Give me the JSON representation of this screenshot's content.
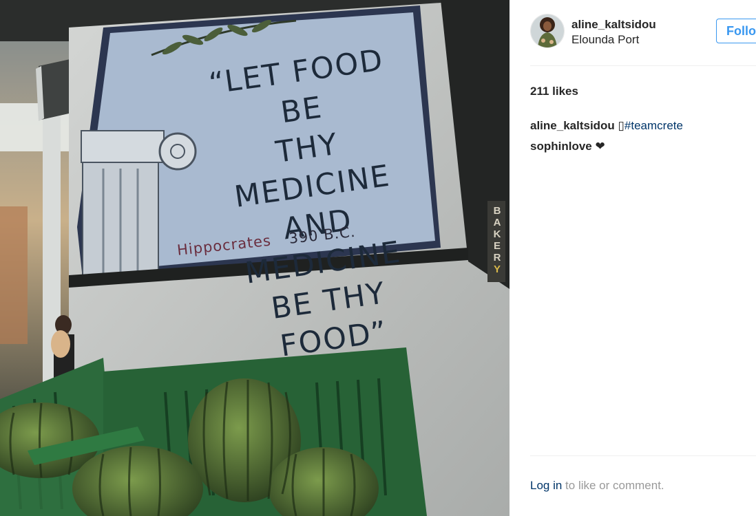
{
  "photo": {
    "sign_lines": [
      "“Let food be",
      "thy medicine",
      "and medicine",
      "be thy food”"
    ],
    "sign_author": "Hippocrates",
    "sign_year": "390 B.C.",
    "bakery_letters": [
      "B",
      "A",
      "K",
      "E",
      "R",
      "Y"
    ]
  },
  "post": {
    "username": "aline_kaltsidou",
    "location": "Elounda Port",
    "follow_label": "Follo",
    "likes": "211 likes",
    "comments": [
      {
        "user": "aline_kaltsidou",
        "text": " ▯",
        "tag": "#teamcrete"
      },
      {
        "user": "sophinlove",
        "text": " ❤",
        "tag": ""
      }
    ],
    "login_link": "Log in",
    "login_suffix": " to like or comment."
  },
  "colors": {
    "accent": "#3897f0",
    "link": "#003569",
    "muted": "#999999",
    "divider": "#efefef"
  }
}
